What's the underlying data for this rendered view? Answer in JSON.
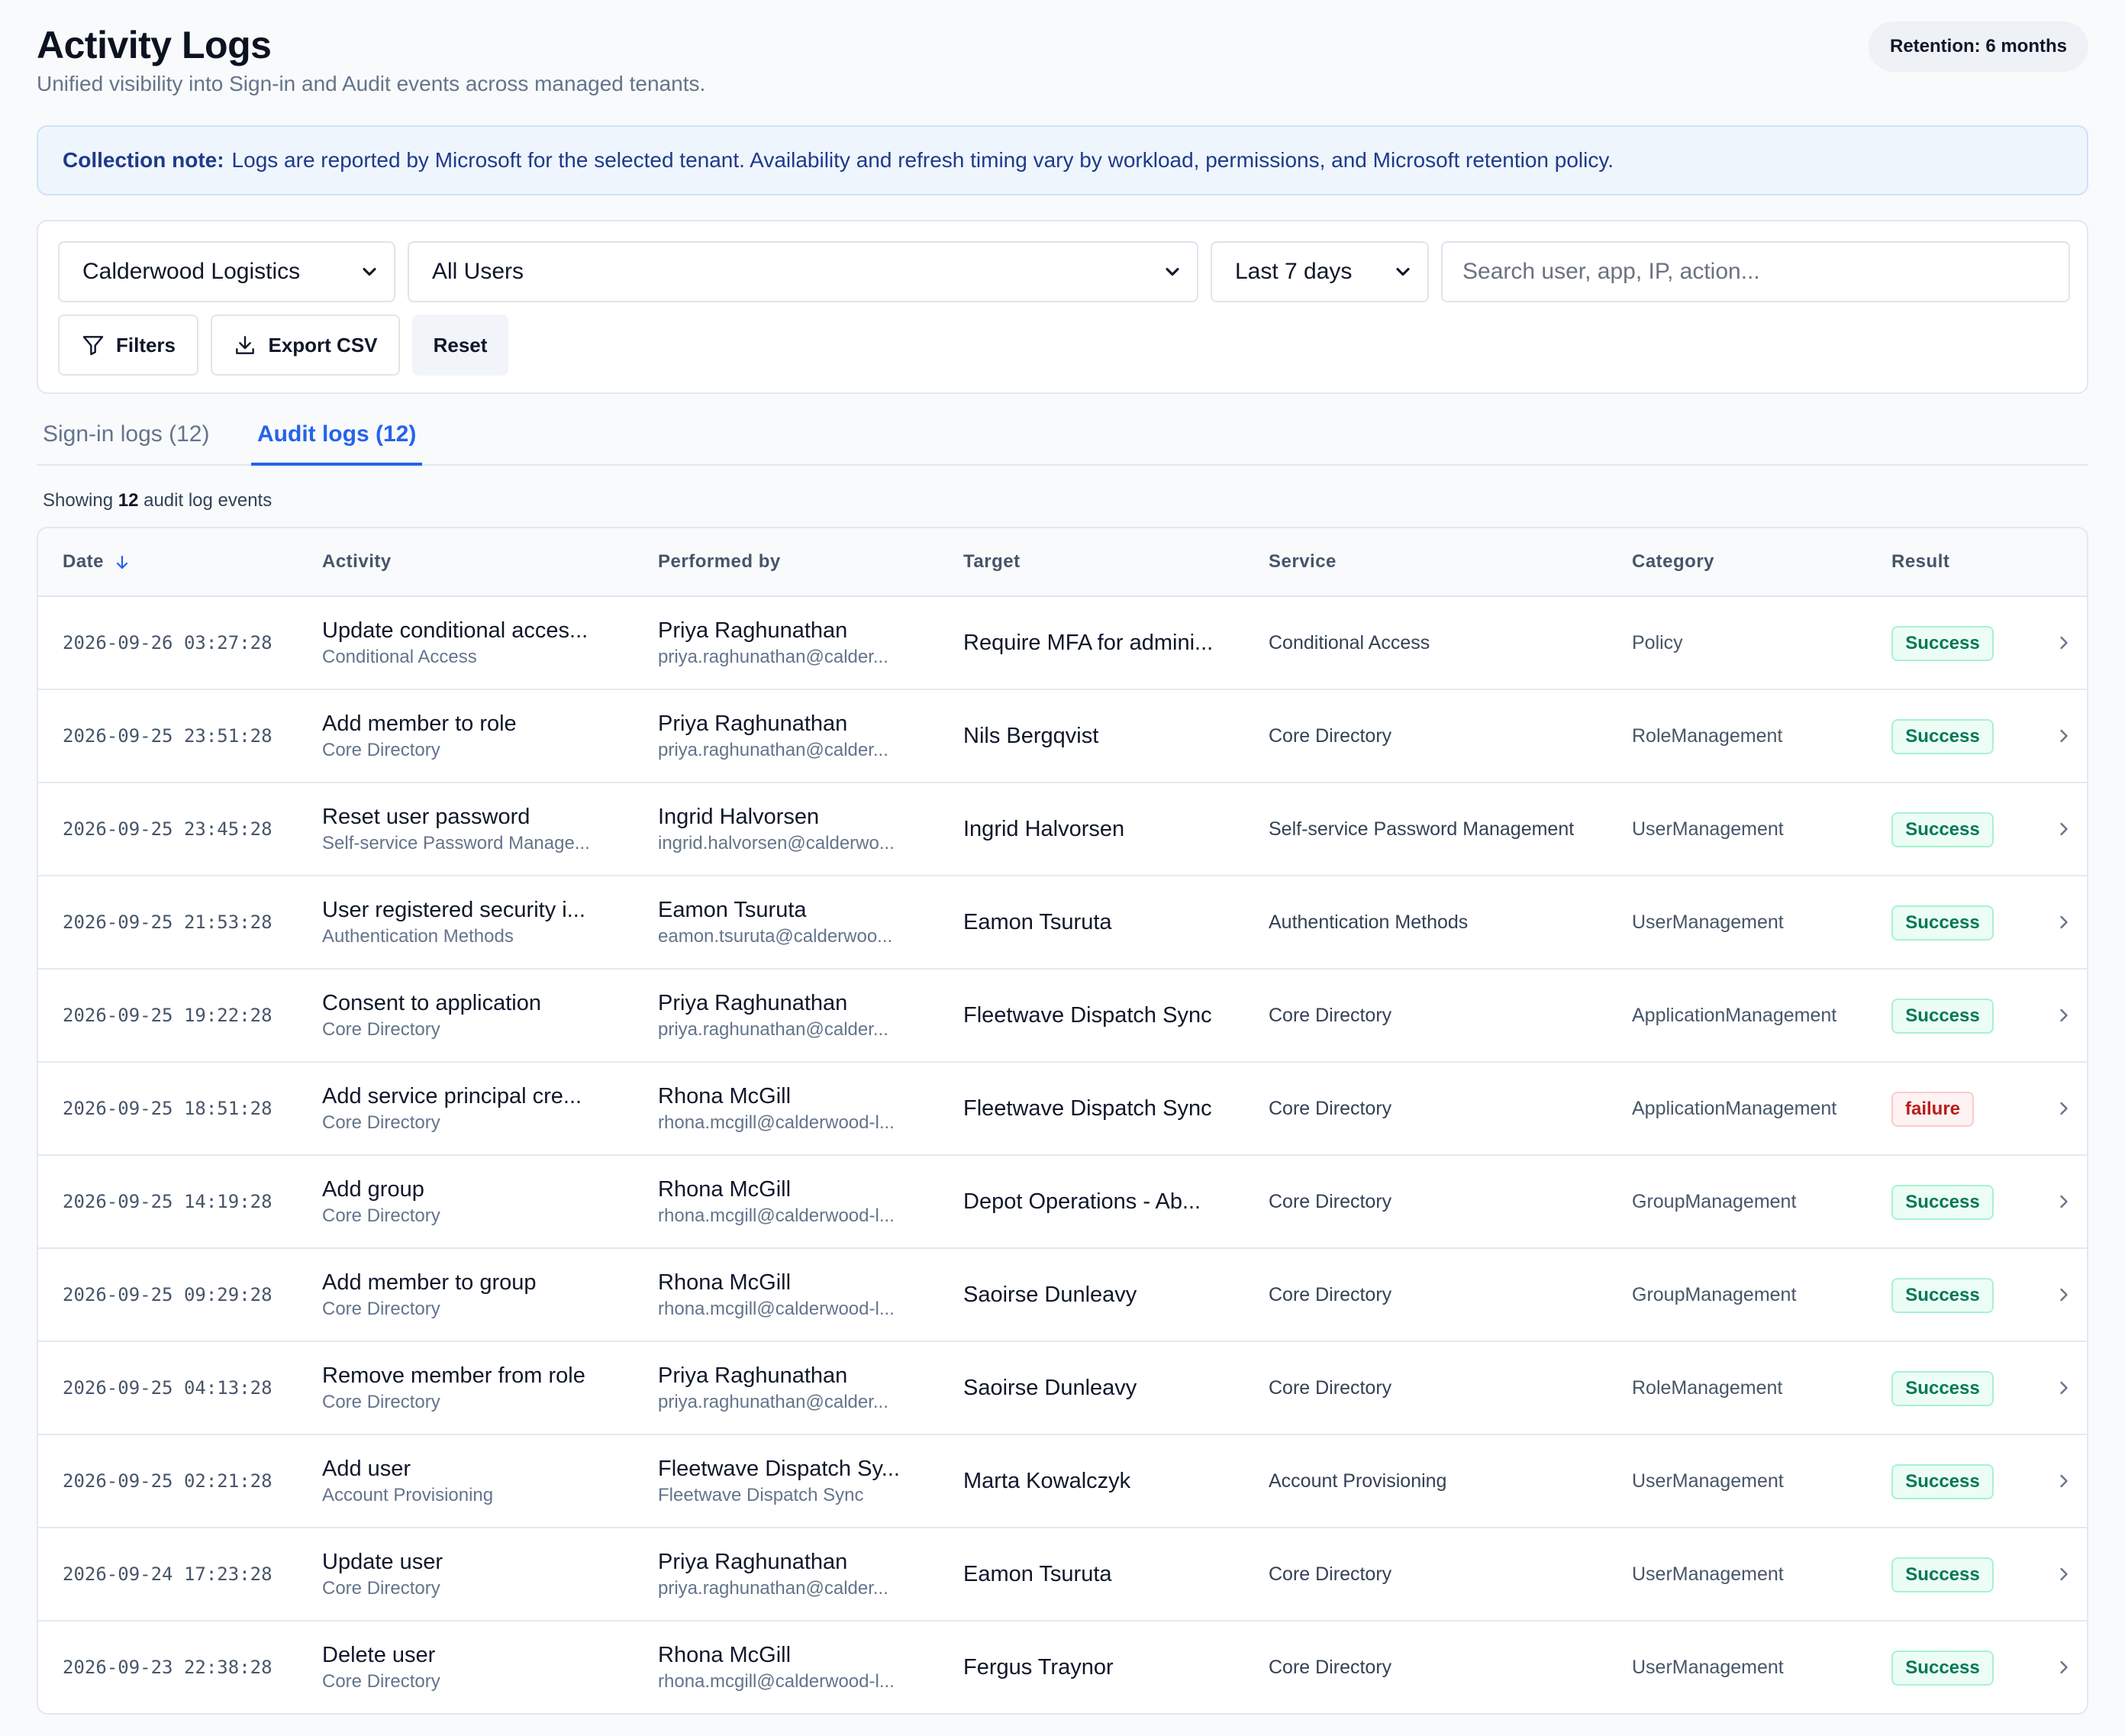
{
  "header": {
    "title": "Activity Logs",
    "subtitle": "Unified visibility into Sign-in and Audit events across managed tenants.",
    "retention": "Retention: 6 months"
  },
  "note": {
    "label": "Collection note:",
    "text": "Logs are reported by Microsoft for the selected tenant. Availability and refresh timing vary by workload, permissions, and Microsoft retention policy."
  },
  "filters": {
    "tenant": "Calderwood Logistics",
    "users": "All Users",
    "range": "Last 7 days",
    "search_placeholder": "Search user, app, IP, action...",
    "filters_label": "Filters",
    "export_label": "Export CSV",
    "reset_label": "Reset"
  },
  "tabs": [
    {
      "label": "Sign-in logs (12)",
      "active": false
    },
    {
      "label": "Audit logs (12)",
      "active": true
    }
  ],
  "showing": {
    "prefix": "Showing",
    "count": "12",
    "suffix": "audit log events"
  },
  "columns": [
    "Date",
    "Activity",
    "Performed by",
    "Target",
    "Service",
    "Category",
    "Result"
  ],
  "rows": [
    {
      "date": "2026-09-26 03:27:28",
      "activity": "Update conditional acces...",
      "activity_sub": "Conditional Access",
      "by": "Priya Raghunathan",
      "by_sub": "priya.raghunathan@calder...",
      "target": "Require MFA for admini...",
      "service": "Conditional Access",
      "category": "Policy",
      "result": "Success"
    },
    {
      "date": "2026-09-25 23:51:28",
      "activity": "Add member to role",
      "activity_sub": "Core Directory",
      "by": "Priya Raghunathan",
      "by_sub": "priya.raghunathan@calder...",
      "target": "Nils Bergqvist",
      "service": "Core Directory",
      "category": "RoleManagement",
      "result": "Success"
    },
    {
      "date": "2026-09-25 23:45:28",
      "activity": "Reset user password",
      "activity_sub": "Self-service Password Manage...",
      "by": "Ingrid Halvorsen",
      "by_sub": "ingrid.halvorsen@calderwo...",
      "target": "Ingrid Halvorsen",
      "service": "Self-service Password Management",
      "category": "UserManagement",
      "result": "Success"
    },
    {
      "date": "2026-09-25 21:53:28",
      "activity": "User registered security i...",
      "activity_sub": "Authentication Methods",
      "by": "Eamon Tsuruta",
      "by_sub": "eamon.tsuruta@calderwoo...",
      "target": "Eamon Tsuruta",
      "service": "Authentication Methods",
      "category": "UserManagement",
      "result": "Success"
    },
    {
      "date": "2026-09-25 19:22:28",
      "activity": "Consent to application",
      "activity_sub": "Core Directory",
      "by": "Priya Raghunathan",
      "by_sub": "priya.raghunathan@calder...",
      "target": "Fleetwave Dispatch Sync",
      "service": "Core Directory",
      "category": "ApplicationManagement",
      "result": "Success"
    },
    {
      "date": "2026-09-25 18:51:28",
      "activity": "Add service principal cre...",
      "activity_sub": "Core Directory",
      "by": "Rhona McGill",
      "by_sub": "rhona.mcgill@calderwood-l...",
      "target": "Fleetwave Dispatch Sync",
      "service": "Core Directory",
      "category": "ApplicationManagement",
      "result": "failure"
    },
    {
      "date": "2026-09-25 14:19:28",
      "activity": "Add group",
      "activity_sub": "Core Directory",
      "by": "Rhona McGill",
      "by_sub": "rhona.mcgill@calderwood-l...",
      "target": "Depot Operations - Ab...",
      "service": "Core Directory",
      "category": "GroupManagement",
      "result": "Success"
    },
    {
      "date": "2026-09-25 09:29:28",
      "activity": "Add member to group",
      "activity_sub": "Core Directory",
      "by": "Rhona McGill",
      "by_sub": "rhona.mcgill@calderwood-l...",
      "target": "Saoirse Dunleavy",
      "service": "Core Directory",
      "category": "GroupManagement",
      "result": "Success"
    },
    {
      "date": "2026-09-25 04:13:28",
      "activity": "Remove member from role",
      "activity_sub": "Core Directory",
      "by": "Priya Raghunathan",
      "by_sub": "priya.raghunathan@calder...",
      "target": "Saoirse Dunleavy",
      "service": "Core Directory",
      "category": "RoleManagement",
      "result": "Success"
    },
    {
      "date": "2026-09-25 02:21:28",
      "activity": "Add user",
      "activity_sub": "Account Provisioning",
      "by": "Fleetwave Dispatch Sy...",
      "by_sub": "Fleetwave Dispatch Sync",
      "target": "Marta Kowalczyk",
      "service": "Account Provisioning",
      "category": "UserManagement",
      "result": "Success"
    },
    {
      "date": "2026-09-24 17:23:28",
      "activity": "Update user",
      "activity_sub": "Core Directory",
      "by": "Priya Raghunathan",
      "by_sub": "priya.raghunathan@calder...",
      "target": "Eamon Tsuruta",
      "service": "Core Directory",
      "category": "UserManagement",
      "result": "Success"
    },
    {
      "date": "2026-09-23 22:38:28",
      "activity": "Delete user",
      "activity_sub": "Core Directory",
      "by": "Rhona McGill",
      "by_sub": "rhona.mcgill@calderwood-l...",
      "target": "Fergus Traynor",
      "service": "Core Directory",
      "category": "UserManagement",
      "result": "Success"
    }
  ],
  "colors": {
    "accent": "#2563eb",
    "success": "#047857",
    "failure": "#b91c1c"
  }
}
